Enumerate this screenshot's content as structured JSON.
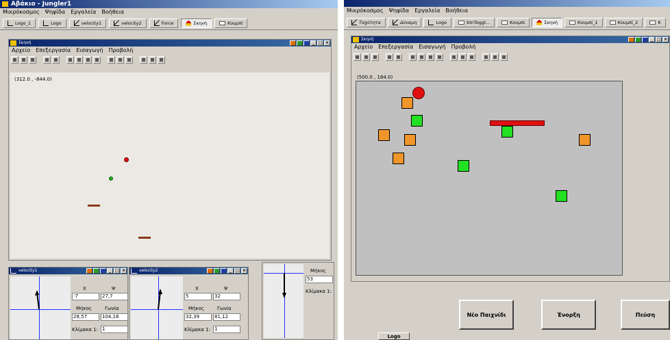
{
  "left_app": {
    "title": "Αβάκιο - Jungler1",
    "menu": [
      "Μικρόκοσμος",
      "Ψηφίδα",
      "Εργαλεία",
      "Βοήθεια"
    ],
    "tabs": [
      {
        "label": "Logo_1",
        "icon": "logo-L-icon"
      },
      {
        "label": "Logo",
        "icon": "logo-L-icon"
      },
      {
        "label": "velocity1",
        "icon": "line-icon"
      },
      {
        "label": "velocity2",
        "icon": "line-icon"
      },
      {
        "label": "Force",
        "icon": "line-icon"
      },
      {
        "label": "Σκηνή",
        "icon": "scene-icon",
        "selected": true
      },
      {
        "label": "Κουμπί",
        "icon": "button-icon"
      }
    ],
    "scene_window": {
      "title": "Σκηνή",
      "menu": [
        "Αρχείο",
        "Επεξεργασία",
        "Εισαγωγή",
        "Προβολή"
      ],
      "coord": "(312.0 , -844.0)"
    },
    "velocity1": {
      "title": "velocity1",
      "x_label": "X",
      "y_label": "Ψ",
      "x": "-7",
      "y": "27,7",
      "len_label": "Μήκος",
      "ang_label": "Γωνία",
      "len": "28,57",
      "ang": "104,18",
      "scale_label": "Κλίμακα 1:",
      "scale": "1"
    },
    "velocity2": {
      "title": "velocity2",
      "x_label": "X",
      "y_label": "Ψ",
      "x": "5",
      "y": "32",
      "len_label": "Μήκος",
      "ang_label": "Γωνία",
      "len": "32,39",
      "ang": "81,12",
      "scale_label": "Κλίμακα 1:",
      "scale": "1"
    },
    "force": {
      "len_label": "Μήκος",
      "len": "53",
      "scale_label": "Κλίμακα 1:"
    }
  },
  "right_app": {
    "menu": [
      "Μικρόκοσμος",
      "Ψηφίδα",
      "Εργαλεία",
      "Βοήθεια"
    ],
    "tabs": [
      {
        "label": "Ταχύτητα",
        "icon": "line-icon"
      },
      {
        "label": "Δύναμη",
        "icon": "line-icon"
      },
      {
        "label": "Logo",
        "icon": "logo-L-icon"
      },
      {
        "label": "btnToggl...",
        "icon": "button-icon"
      },
      {
        "label": "Κουμπί",
        "icon": "button-icon"
      },
      {
        "label": "Σκηνή",
        "icon": "scene-icon",
        "selected": true
      },
      {
        "label": "Κουμπί_1",
        "icon": "button-icon"
      },
      {
        "label": "Κουμπί_2",
        "icon": "button-icon"
      },
      {
        "label": "Κ",
        "icon": "button-icon"
      }
    ],
    "scene_window": {
      "title": "Σκηνή",
      "menu": [
        "Αρχείο",
        "Επεξεργασία",
        "Εισαγωγή",
        "Προβολή"
      ],
      "coord": "(500.0 , 184.0)"
    },
    "buttons": {
      "new_game": "Νέο Παιχνίδι",
      "activate": "Ένορξη",
      "fall": "Πεύση"
    },
    "logo_label": "Logo"
  }
}
